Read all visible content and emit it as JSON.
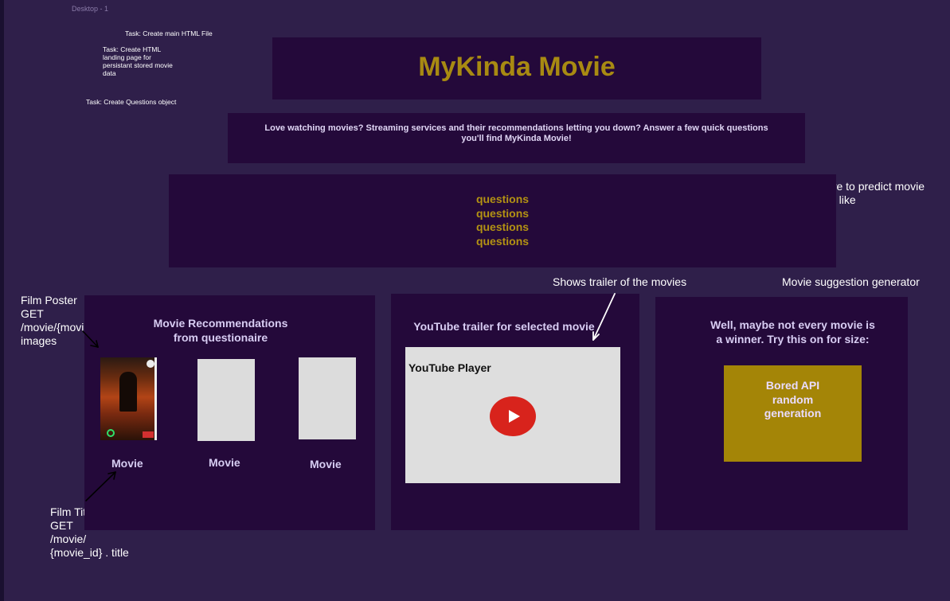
{
  "canvas": {
    "frame_label": "Desktop - 1",
    "bg_color": "#2f1f4a",
    "panel_color": "#24093a",
    "accent_color": "#a88a12"
  },
  "notes": {
    "task_main_html": "Task: Create main HTML File",
    "task_landing_page": "Task: Create HTML\nlanding page for\npersistant stored movie\ndata",
    "task_questions": "Task: Create Questions object",
    "questionnaire": "Questoniare to predict movie\nuser would like",
    "trailer": "Shows trailer of the movies",
    "suggestion": "Movie suggestion generator",
    "film_poster": "Film Poster\nGET\n/movie/{movie_id}/\nimages",
    "film_title": "Film Title\nGET\n/movie/\n{movie_id} . title"
  },
  "header": {
    "title": "MyKinda Movie"
  },
  "intro": {
    "text": "Love watching movies? Streaming services and their recommendations letting you down? Answer a few quick questions you'll find MyKinda Movie!"
  },
  "questions": [
    "questions",
    "questions",
    "questions",
    "questions"
  ],
  "recommendations": {
    "title": "Movie Recommendations\nfrom questionaire",
    "movies": [
      {
        "label": "Movie"
      },
      {
        "label": "Movie"
      },
      {
        "label": "Movie"
      }
    ]
  },
  "trailer": {
    "title": "YouTube trailer for selected movie",
    "player_label": "YouTube Player",
    "icon": "play-icon",
    "play_color": "#d8231c"
  },
  "suggestion": {
    "title": "Well, maybe not every movie is\na winner. Try this on for size:",
    "button_text": "Bored API\nrandom\ngeneration",
    "button_color": "#a48507"
  }
}
